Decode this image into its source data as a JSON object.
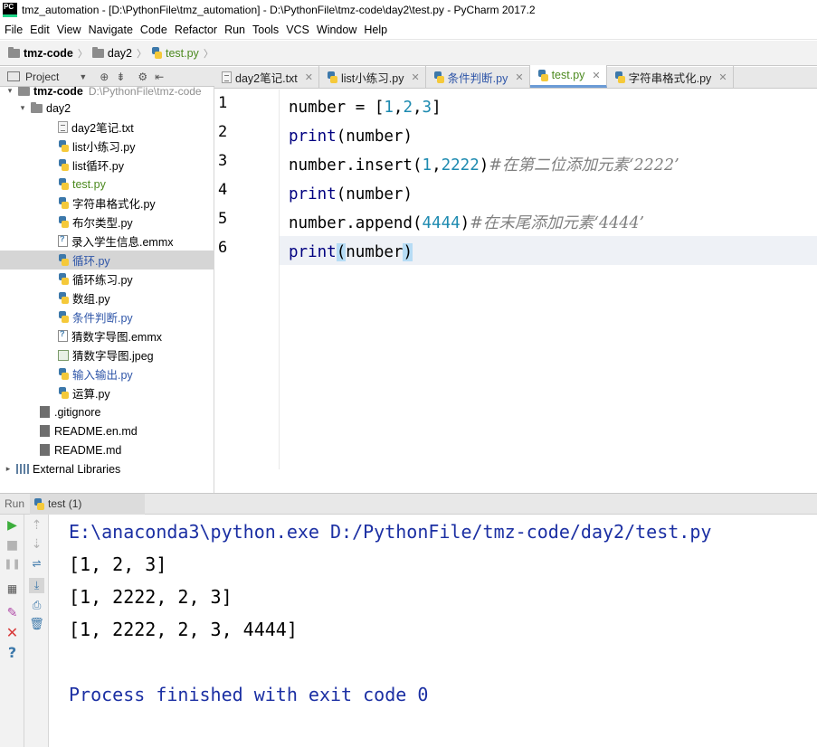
{
  "window": {
    "title": "tmz_automation - [D:\\PythonFile\\tmz_automation] - D:\\PythonFile\\tmz-code\\day2\\test.py - PyCharm 2017.2",
    "app_icon": "PC"
  },
  "menu": [
    "File",
    "Edit",
    "View",
    "Navigate",
    "Code",
    "Refactor",
    "Run",
    "Tools",
    "VCS",
    "Window",
    "Help"
  ],
  "breadcrumb": [
    "tmz-code",
    "day2",
    "test.py"
  ],
  "project_panel": {
    "title": "Project",
    "tree": [
      {
        "label": "tmz-code",
        "hint": "D:\\PythonFile\\tmz-code",
        "type": "folder",
        "depth": 0
      },
      {
        "label": "day2",
        "type": "folder",
        "depth": 1
      },
      {
        "label": "day2笔记.txt",
        "type": "txt",
        "depth": 2
      },
      {
        "label": "list小练习.py",
        "type": "py",
        "depth": 2
      },
      {
        "label": "list循环.py",
        "type": "py",
        "depth": 2
      },
      {
        "label": "test.py",
        "type": "py",
        "depth": 2,
        "color": "green"
      },
      {
        "label": "字符串格式化.py",
        "type": "py",
        "depth": 2
      },
      {
        "label": "布尔类型.py",
        "type": "py",
        "depth": 2
      },
      {
        "label": "录入学生信息.emmx",
        "type": "emmx",
        "depth": 2
      },
      {
        "label": "循环.py",
        "type": "py",
        "depth": 2,
        "color": "blue",
        "selected": true
      },
      {
        "label": "循环练习.py",
        "type": "py",
        "depth": 2
      },
      {
        "label": "数组.py",
        "type": "py",
        "depth": 2
      },
      {
        "label": "条件判断.py",
        "type": "py",
        "depth": 2,
        "color": "blue"
      },
      {
        "label": "猜数字导图.emmx",
        "type": "emmx",
        "depth": 2
      },
      {
        "label": "猜数字导图.jpeg",
        "type": "img",
        "depth": 2
      },
      {
        "label": "输入输出.py",
        "type": "py",
        "depth": 2,
        "color": "blue"
      },
      {
        "label": "运算.py",
        "type": "py",
        "depth": 2
      },
      {
        "label": ".gitignore",
        "type": "gray",
        "depth": 1
      },
      {
        "label": "README.en.md",
        "type": "gray",
        "depth": 1
      },
      {
        "label": "README.md",
        "type": "gray",
        "depth": 1
      },
      {
        "label": "External Libraries",
        "type": "lib",
        "depth": 0
      }
    ]
  },
  "tabs": [
    {
      "label": "day2笔记.txt",
      "icon": "txt"
    },
    {
      "label": "list小练习.py",
      "icon": "py"
    },
    {
      "label": "条件判断.py",
      "icon": "py",
      "color": "blue"
    },
    {
      "label": "test.py",
      "icon": "py",
      "color": "green",
      "active": true
    },
    {
      "label": "字符串格式化.py",
      "icon": "py"
    }
  ],
  "editor": {
    "line_numbers": [
      "1",
      "2",
      "3",
      "4",
      "5",
      "6"
    ],
    "lines": {
      "l1_a": "number = [",
      "l1_n1": "1",
      "l1_c1": ",",
      "l1_n2": "2",
      "l1_c2": ",",
      "l1_n3": "3",
      "l1_b": "]",
      "l2_fn": "print",
      "l2_rest": "(number)",
      "l3_a": "number.insert(",
      "l3_n1": "1",
      "l3_c": ",",
      "l3_n2": "2222",
      "l3_b": ")",
      "l3_cm": "#在第二位添加元素‘2222’",
      "l4_fn": "print",
      "l4_rest": "(number)",
      "l5_a": "number.append(",
      "l5_n": "4444",
      "l5_b": ")",
      "l5_cm": "#在末尾添加元素‘4444’",
      "l6_fn": "print",
      "l6_p1": "(",
      "l6_mid": "number",
      "l6_p2": ")"
    }
  },
  "run_panel": {
    "label": "Run",
    "tab": "test (1)",
    "console": [
      "E:\\anaconda3\\python.exe D:/PythonFile/tmz-code/day2/test.py",
      "[1, 2, 3]",
      "[1, 2222, 2, 3]",
      "[1, 2222, 2, 3, 4444]",
      "",
      "Process finished with exit code 0"
    ]
  },
  "colors": {
    "number": "#1d8ab0",
    "builtin": "#000080",
    "comment": "#7f7f7f",
    "console_cmd": "#1b2fa3",
    "selection": "#d5d5d5"
  }
}
